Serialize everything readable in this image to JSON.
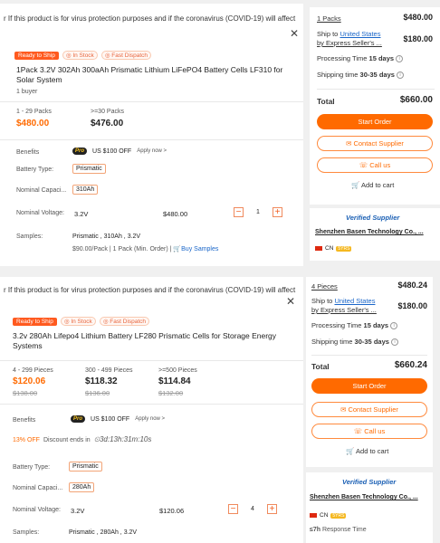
{
  "top": {
    "banner": "r If this product is for virus protection purposes and if the coronavirus (COVID-19) will affect",
    "tags": {
      "ready": "Ready to Ship",
      "stock": "In Stock",
      "dispatch": "Fast Dispatch"
    },
    "title": "1Pack 3.2V 302Ah 300aAh Prismatic Lithium LiFePO4 Battery Cells LF310 for Solar System",
    "buyers": "1 buyer",
    "tiers": [
      {
        "range": "1 - 29 Packs",
        "price": "$480.00"
      },
      {
        "range": ">=30 Packs",
        "price": "$476.00"
      }
    ],
    "benefits_label": "Benefits",
    "pro": "Pro",
    "benefit_text": "US $100 OFF",
    "apply": "Apply now >",
    "battery_type_label": "Battery Type:",
    "battery_type": "Prismatic",
    "capacity_label": "Nominal Capaci...",
    "capacity": "310Ah",
    "voltage_label": "Nominal Voltage:",
    "voltage": "3.2V",
    "unit_price": "$480.00",
    "qty": "1",
    "samples_label": "Samples:",
    "samples_spec": "Prismatic , 310Ah , 3.2V",
    "samples_price": "$90.00/Pack | 1 Pack (Min. Order) |",
    "buy_samples": "Buy Samples",
    "summary": {
      "packs": "1 Packs",
      "packs_price": "$480.00",
      "ship_to": "Ship to",
      "country": "United States",
      "by": "by Express Seller's ...",
      "ship_price": "$180.00",
      "processing_label": "Processing Time",
      "processing": "15 days",
      "shipping_label": "Shipping time",
      "shipping": "30-35 days",
      "total_label": "Total",
      "total": "$660.00",
      "start_order": "Start Order",
      "contact": "Contact Supplier",
      "call": "Call us",
      "add_cart": "Add to cart"
    },
    "supplier": {
      "verified": "Verified Supplier",
      "name": "Shenzhen Basen Technology Co., ...",
      "country": "CN",
      "years": "5YRS"
    }
  },
  "bottom": {
    "banner": "r If this product is for virus protection purposes and if the coronavirus (COVID-19) will affect",
    "tags": {
      "ready": "Ready to Ship",
      "stock": "In Stock",
      "dispatch": "Fast Dispatch"
    },
    "title": "3.2v 280Ah Lifepo4 Lithium Battery LF280 Prismatic Cells for Storage Energy Systems",
    "tiers": [
      {
        "range": "4 - 299 Pieces",
        "price": "$120.06",
        "old": "$138.00"
      },
      {
        "range": "300 - 499 Pieces",
        "price": "$118.32",
        "old": "$136.00"
      },
      {
        "range": ">=500 Pieces",
        "price": "$114.84",
        "old": "$132.00"
      }
    ],
    "benefits_label": "Benefits",
    "pro": "Pro",
    "benefit_text": "US $100 OFF",
    "apply": "Apply now >",
    "discount_pct": "13% OFF",
    "discount_text": "Discount ends in",
    "countdown": "3d:13h:31m:10s",
    "battery_type_label": "Battery Type:",
    "battery_type": "Prismatic",
    "capacity_label": "Nominal Capaci...",
    "capacity": "280Ah",
    "voltage_label": "Nominal Voltage:",
    "voltage": "3.2V",
    "unit_price": "$120.06",
    "qty": "4",
    "samples_label": "Samples:",
    "samples_spec": "Prismatic , 280Ah , 3.2V",
    "summary": {
      "packs": "4 Pieces",
      "packs_price": "$480.24",
      "ship_to": "Ship to",
      "country": "United States",
      "by": "by Express Seller's ...",
      "ship_price": "$180.00",
      "processing_label": "Processing Time",
      "processing": "15 days",
      "shipping_label": "Shipping time",
      "shipping": "30-35 days",
      "total_label": "Total",
      "total": "$660.24",
      "start_order": "Start Order",
      "contact": "Contact Supplier",
      "call": "Call us",
      "add_cart": "Add to cart"
    },
    "supplier": {
      "verified": "Verified Supplier",
      "name": "Shenzhen Basen Technology Co., ...",
      "country": "CN",
      "years": "5YRS",
      "response_value": "≤7h",
      "response_label": "Response Time"
    }
  }
}
